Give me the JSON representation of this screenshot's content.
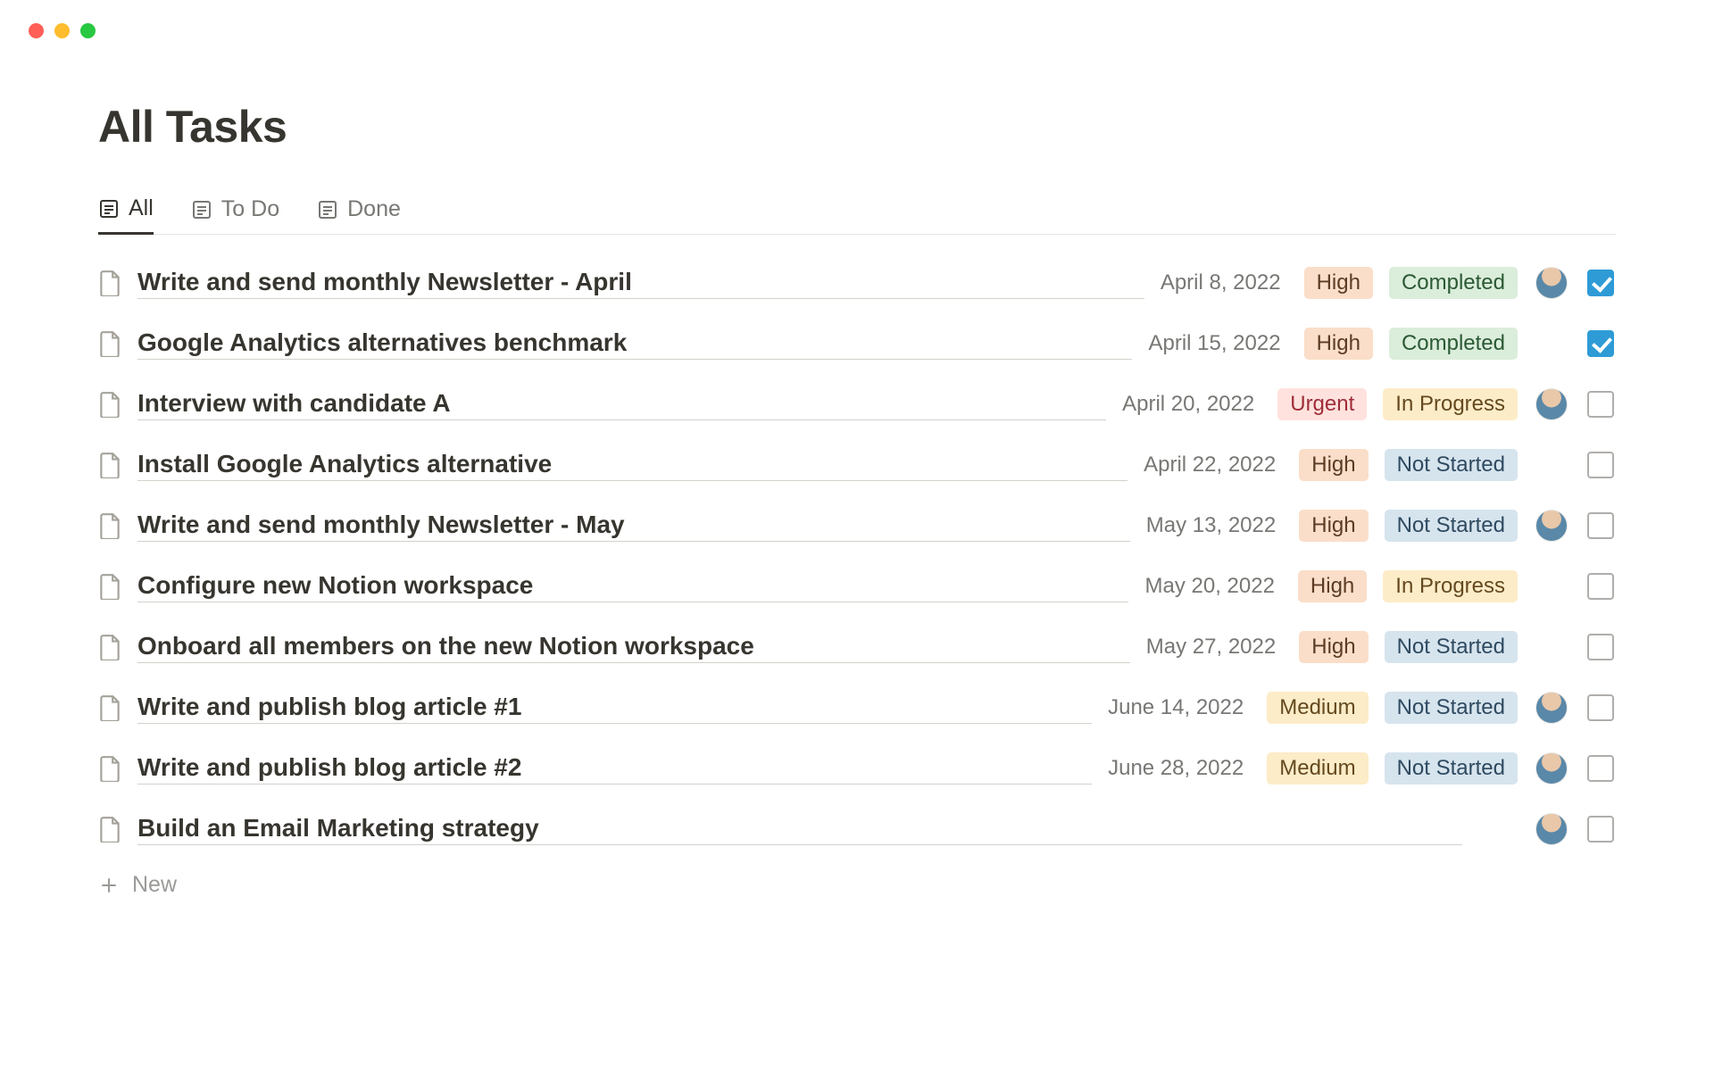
{
  "window": {
    "traffic_lights": [
      "red",
      "yellow",
      "green"
    ]
  },
  "header": {
    "title": "All Tasks"
  },
  "tabs": [
    {
      "label": "All",
      "active": true
    },
    {
      "label": "To Do",
      "active": false
    },
    {
      "label": "Done",
      "active": false
    }
  ],
  "priority_labels": {
    "high": "High",
    "urgent": "Urgent",
    "medium": "Medium"
  },
  "status_labels": {
    "completed": "Completed",
    "inprogress": "In Progress",
    "notstarted": "Not Started"
  },
  "tasks": [
    {
      "title": "Write and send monthly Newsletter - April",
      "date": "April 8, 2022",
      "priority": "high",
      "status": "completed",
      "has_avatar": true,
      "checked": true
    },
    {
      "title": "Google Analytics alternatives benchmark",
      "date": "April 15, 2022",
      "priority": "high",
      "status": "completed",
      "has_avatar": false,
      "checked": true
    },
    {
      "title": "Interview with candidate A",
      "date": "April 20, 2022",
      "priority": "urgent",
      "status": "inprogress",
      "has_avatar": true,
      "checked": false
    },
    {
      "title": "Install Google Analytics alternative",
      "date": "April 22, 2022",
      "priority": "high",
      "status": "notstarted",
      "has_avatar": false,
      "checked": false
    },
    {
      "title": "Write and send monthly Newsletter - May",
      "date": "May 13, 2022",
      "priority": "high",
      "status": "notstarted",
      "has_avatar": true,
      "checked": false
    },
    {
      "title": "Configure new Notion workspace",
      "date": "May 20, 2022",
      "priority": "high",
      "status": "inprogress",
      "has_avatar": false,
      "checked": false
    },
    {
      "title": "Onboard all members on the new Notion workspace",
      "date": "May 27, 2022",
      "priority": "high",
      "status": "notstarted",
      "has_avatar": false,
      "checked": false
    },
    {
      "title": "Write and publish blog article #1",
      "date": "June 14, 2022",
      "priority": "medium",
      "status": "notstarted",
      "has_avatar": true,
      "checked": false
    },
    {
      "title": "Write and publish blog article #2",
      "date": "June 28, 2022",
      "priority": "medium",
      "status": "notstarted",
      "has_avatar": true,
      "checked": false
    },
    {
      "title": "Build an Email Marketing strategy",
      "date": "",
      "priority": "",
      "status": "",
      "has_avatar": true,
      "checked": false
    }
  ],
  "new_row": {
    "label": "New"
  }
}
